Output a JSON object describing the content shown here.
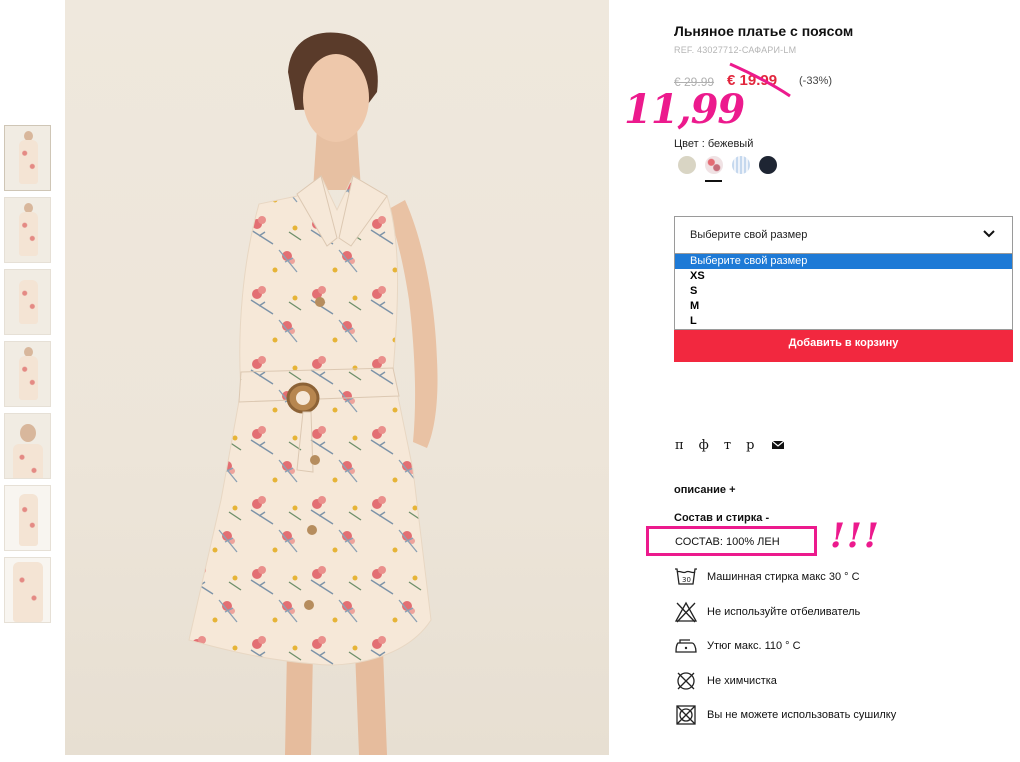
{
  "product": {
    "title": "Льняное платье с поясом",
    "ref": "REF. 43027712-САФАРИ-LM",
    "old_price": "€ 29.99",
    "sale_price": "€ 19.99",
    "discount": "(-33%)",
    "handwritten_price": "11,99"
  },
  "color": {
    "label": "Цвет : бежевый",
    "swatches": [
      "beige",
      "floral-pink",
      "blue-stripe",
      "navy"
    ],
    "selected_index": 1
  },
  "size": {
    "placeholder": "Выберите свой размер",
    "options": [
      "Выберите свой размер",
      "XS",
      "S",
      "M",
      "L"
    ],
    "highlighted_index": 0
  },
  "add_to_cart": "Добавить в корзину",
  "share": {
    "items": [
      "п",
      "ф",
      "т",
      "р"
    ]
  },
  "sections": {
    "description": "описание +",
    "composition": "Состав и стирка -",
    "composition_text": "СОСТАВ: 100% ЛЕН",
    "annotation": "!!!"
  },
  "care": [
    {
      "icon": "wash-30-icon",
      "label": "Машинная стирка макс 30 ° С"
    },
    {
      "icon": "no-bleach-icon",
      "label": "Не используйте отбеливатель"
    },
    {
      "icon": "iron-icon",
      "label": "Утюг макс. 110 ° С"
    },
    {
      "icon": "no-dry-clean-icon",
      "label": "Не химчистка"
    },
    {
      "icon": "no-tumble-dry-icon",
      "label": "Вы не можете использовать сушилку"
    }
  ],
  "colors": {
    "accent_red": "#f2283f",
    "sale_red": "#e2263d",
    "annotation_pink": "#ec1a8d",
    "highlight_blue": "#1e7ad6"
  }
}
